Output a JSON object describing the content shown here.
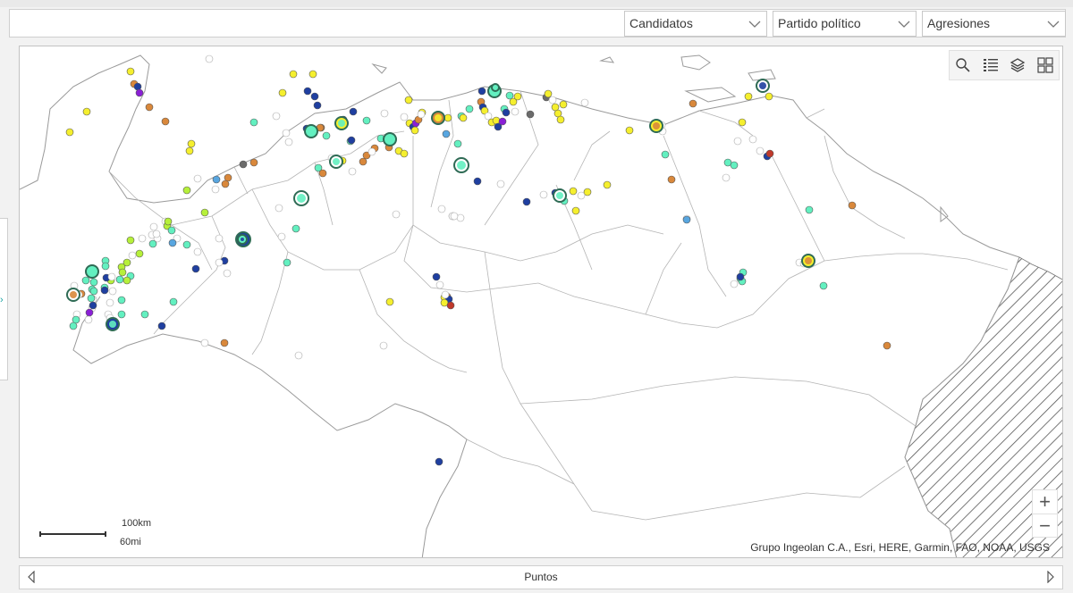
{
  "filters": [
    {
      "label": "Candidatos"
    },
    {
      "label": "Partido político"
    },
    {
      "label": "Agresiones"
    }
  ],
  "map": {
    "tools": [
      {
        "icon": "search-icon"
      },
      {
        "icon": "legend-list-icon"
      },
      {
        "icon": "layers-icon"
      },
      {
        "icon": "basemap-gallery-icon"
      }
    ],
    "zoom_in": "+",
    "zoom_out": "−",
    "scale_km": "100km",
    "scale_mi": "60mi",
    "attribution": "Grupo Ingeolan C.A., Esri, HERE, Garmin, FAO, NOAA, USGS",
    "colors": {
      "yellow": "#f5ef2e",
      "aqua": "#63f0c0",
      "navy": "#1f3fa0",
      "orange": "#d9883b",
      "lime": "#b6f03a",
      "white": "#ffffff",
      "sky": "#58a6e0",
      "purple": "#8a1fd6",
      "gray": "#6b6b6b",
      "red": "#c0392b"
    }
  },
  "bottom": {
    "label": "Puntos"
  }
}
